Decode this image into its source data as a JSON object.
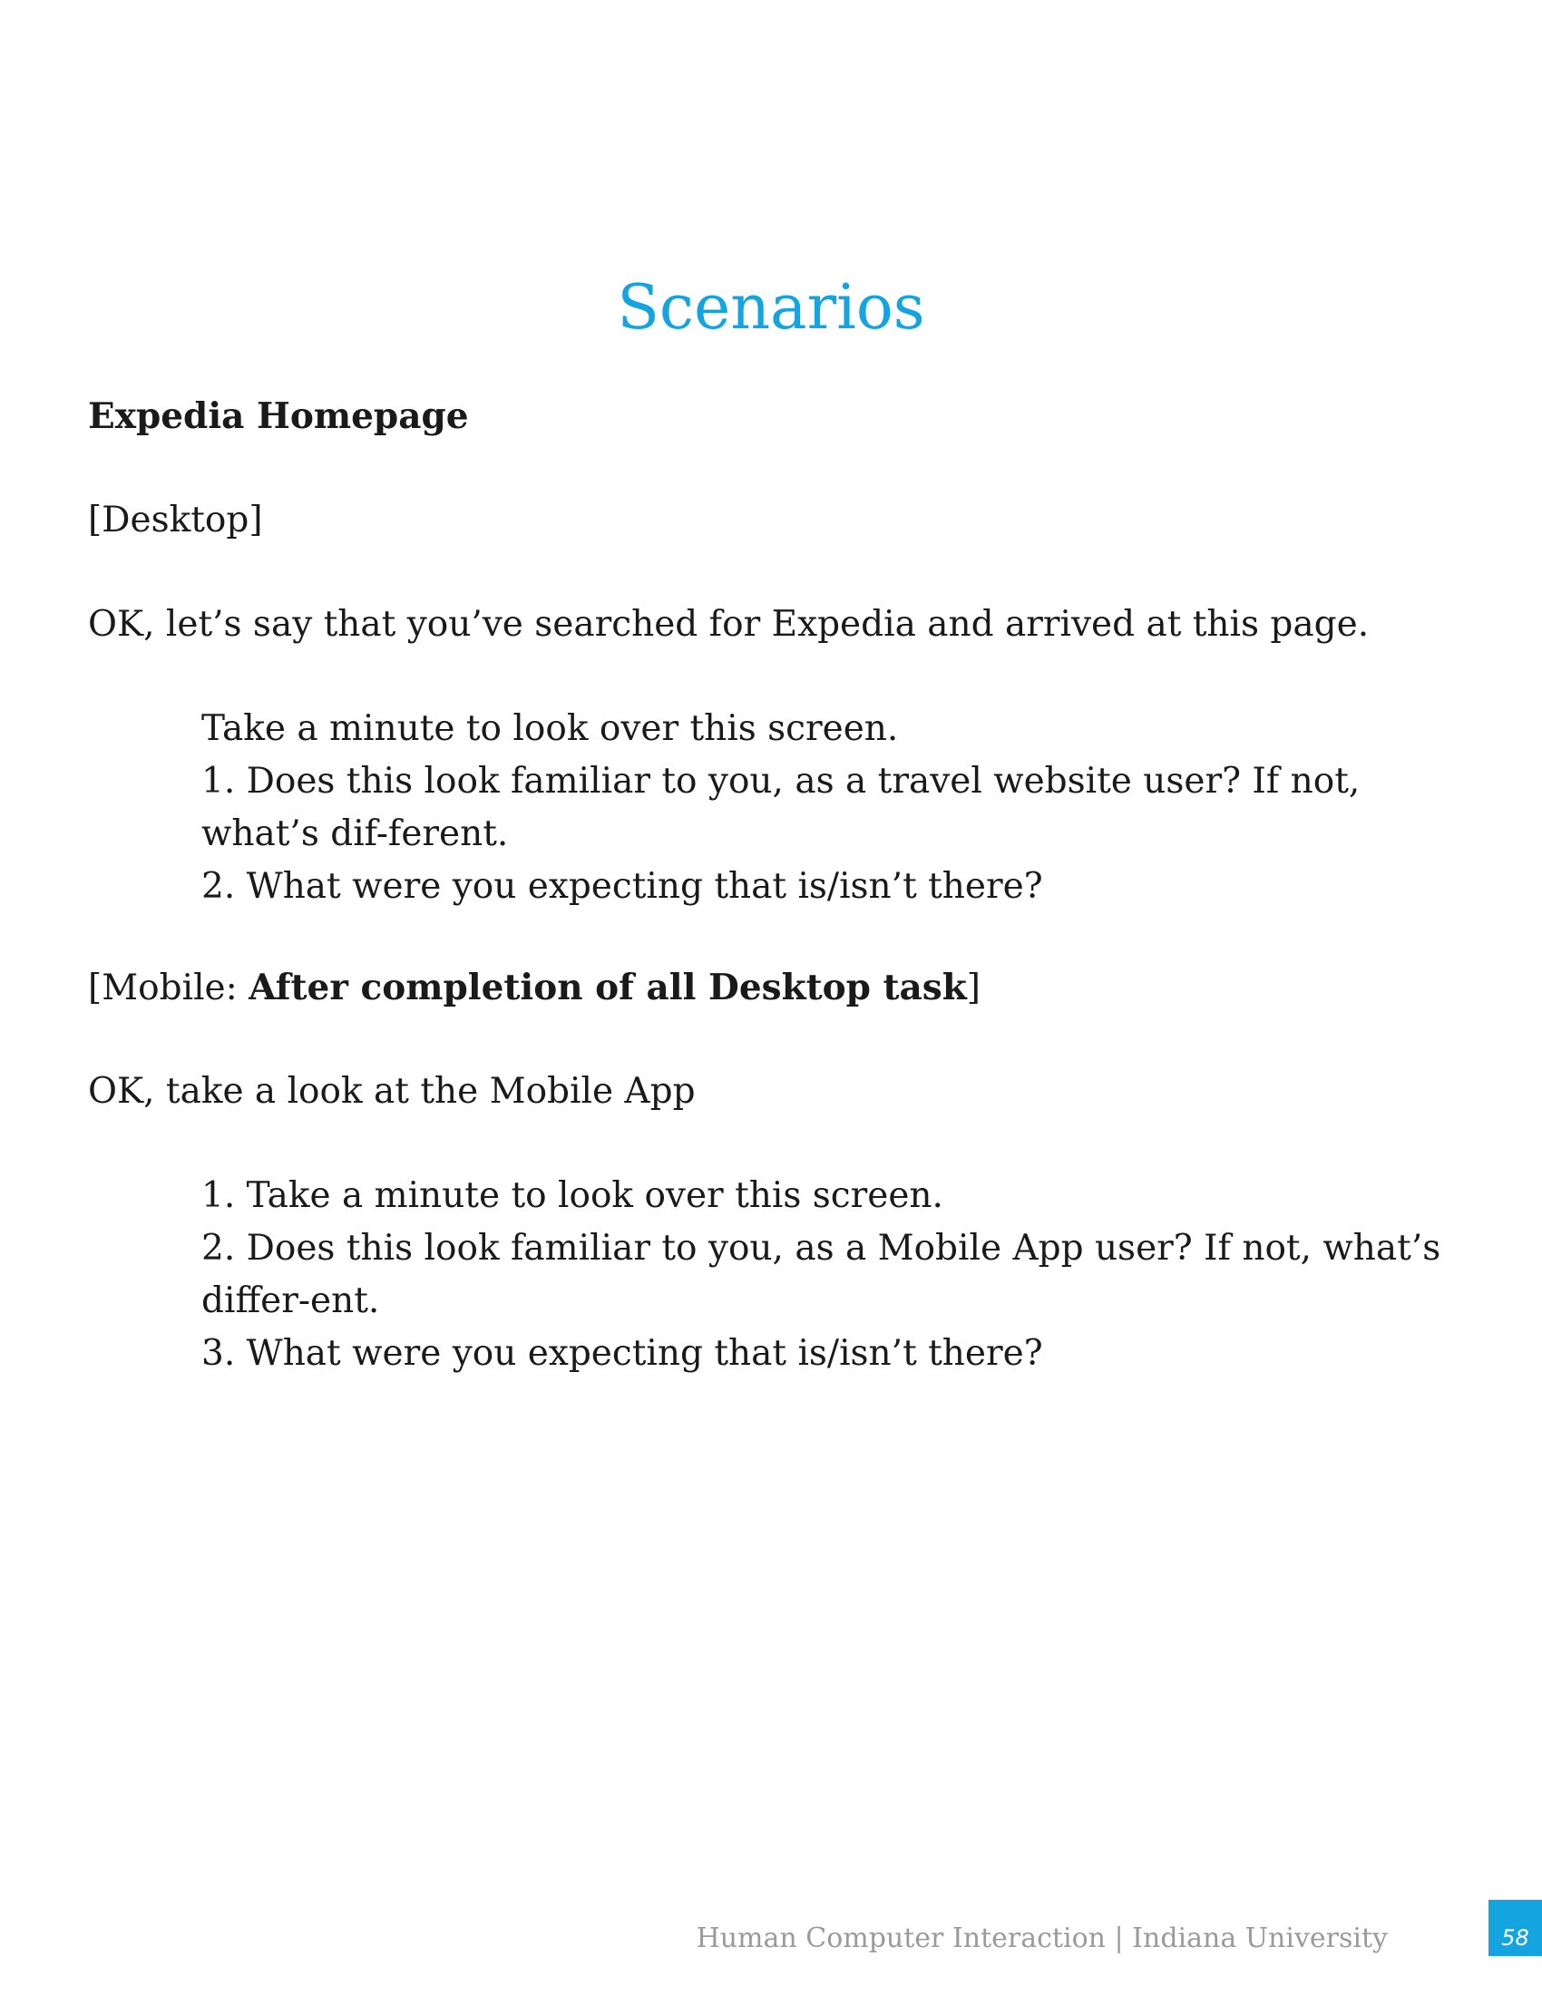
{
  "page": {
    "title": "Scenarios",
    "section_heading": "Expedia Homepage",
    "desktop_label": "[Desktop]",
    "desktop_intro": "OK, let’s say that you’ve searched for Expedia and arrived at this page.",
    "desktop_items": [
      "Take a minute to look over this screen.",
      "1. Does this look familiar to you, as a travel website user? If not, what’s dif-ferent.",
      "2. What were you expecting that is/isn’t there?"
    ],
    "mobile_label_prefix": "[Mobile: ",
    "mobile_label_bold": "After completion of all Desktop task",
    "mobile_label_suffix": "]",
    "mobile_intro": "OK, take a look at the Mobile App",
    "mobile_items": [
      "1. Take a minute to look over this screen.",
      "2. Does this look familiar to you, as a Mobile App user? If not, what’s differ-ent.",
      "3. What were you expecting that is/isn’t there?"
    ]
  },
  "footer": {
    "text": "Human Computer Interaction | Indiana University",
    "page_number": "58",
    "accent_color": "#14a4e0"
  }
}
